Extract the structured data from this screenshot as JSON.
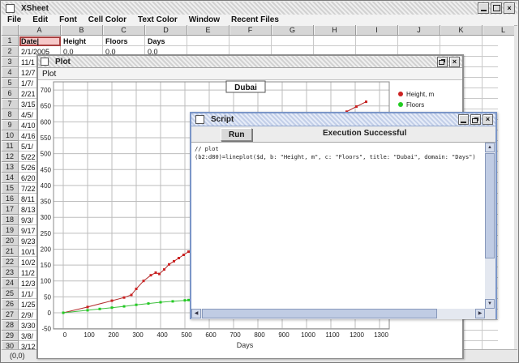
{
  "main_window": {
    "title": "XSheet",
    "menu_items": [
      "File",
      "Edit",
      "Font",
      "Cell Color",
      "Text Color",
      "Window",
      "Recent Files"
    ],
    "status_text": "(0,0)"
  },
  "sheet": {
    "column_headers": [
      "A",
      "B",
      "C",
      "D",
      "E",
      "F",
      "G",
      "H",
      "I",
      "J",
      "K",
      "L"
    ],
    "row_count": 30,
    "selected_cell": "A1",
    "selection_color": "#f6c9c9",
    "header_row": {
      "A": "Date|",
      "B": "Height",
      "C": "Floors",
      "D": "Days"
    },
    "row2": {
      "A": "2/1/2005",
      "B": "0.0",
      "C": "0.0",
      "D": "0.0"
    },
    "colA_dates_rows3_to_30": [
      "11/1",
      "12/7",
      "1/7/",
      "2/21",
      "3/15",
      "4/5/",
      "4/10",
      "4/16",
      "5/1/",
      "5/22",
      "5/26",
      "6/20",
      "7/22",
      "8/11",
      "8/13",
      "9/3/",
      "9/17",
      "9/23",
      "10/1",
      "10/2",
      "11/2",
      "12/3",
      "1/1/",
      "1/25",
      "2/9/",
      "3/30",
      "3/8/",
      "3/12"
    ]
  },
  "plot_window": {
    "title": "Plot",
    "menu": [
      "Plot"
    ]
  },
  "chart_data": {
    "type": "line",
    "title": "Dubai",
    "xlabel": "Days",
    "x_ticks": [
      0,
      100,
      200,
      300,
      400,
      500,
      600,
      700,
      800,
      900,
      1000,
      1100,
      1200,
      1300
    ],
    "y_ticks": [
      -50,
      0,
      50,
      100,
      150,
      200,
      250,
      300,
      350,
      400,
      450,
      500,
      550,
      600,
      650,
      700
    ],
    "xlim": [
      -40,
      1340
    ],
    "ylim": [
      -75,
      730
    ],
    "grid": true,
    "legend_position": "right",
    "series": [
      {
        "name": "Height, m",
        "color": "#b22a2a",
        "marker_color": "#cc2222",
        "points": [
          [
            0,
            0
          ],
          [
            100,
            18
          ],
          [
            200,
            38
          ],
          [
            250,
            48
          ],
          [
            280,
            56
          ],
          [
            300,
            75
          ],
          [
            330,
            100
          ],
          [
            360,
            118
          ],
          [
            380,
            126
          ],
          [
            395,
            122
          ],
          [
            415,
            136
          ],
          [
            435,
            152
          ],
          [
            455,
            162
          ],
          [
            475,
            172
          ],
          [
            495,
            182
          ],
          [
            515,
            192
          ],
          [
            620,
            250
          ],
          [
            720,
            310
          ],
          [
            820,
            370
          ],
          [
            920,
            430
          ],
          [
            1020,
            490
          ],
          [
            1120,
            575
          ],
          [
            1165,
            632
          ],
          [
            1205,
            648
          ],
          [
            1245,
            663
          ]
        ]
      },
      {
        "name": "Floors",
        "color": "#3fbf3f",
        "marker_color": "#22cc22",
        "points": [
          [
            0,
            0
          ],
          [
            100,
            8
          ],
          [
            150,
            12
          ],
          [
            200,
            16
          ],
          [
            250,
            20
          ],
          [
            300,
            25
          ],
          [
            350,
            29
          ],
          [
            400,
            33
          ],
          [
            450,
            36
          ],
          [
            500,
            39
          ],
          [
            515,
            40
          ],
          [
            650,
            55
          ],
          [
            800,
            78
          ],
          [
            950,
            100
          ],
          [
            1100,
            122
          ],
          [
            1245,
            147
          ]
        ]
      }
    ]
  },
  "script_window": {
    "title": "Script",
    "toolbar": {
      "run_label": "Run",
      "status_label": "Execution Successful"
    },
    "code_lines": [
      "// plot",
      "(b2:d80)=lineplot($d, b: \"Height, m\", c: \"Floors\", title: \"Dubai\", domain: \"Days\")"
    ]
  }
}
